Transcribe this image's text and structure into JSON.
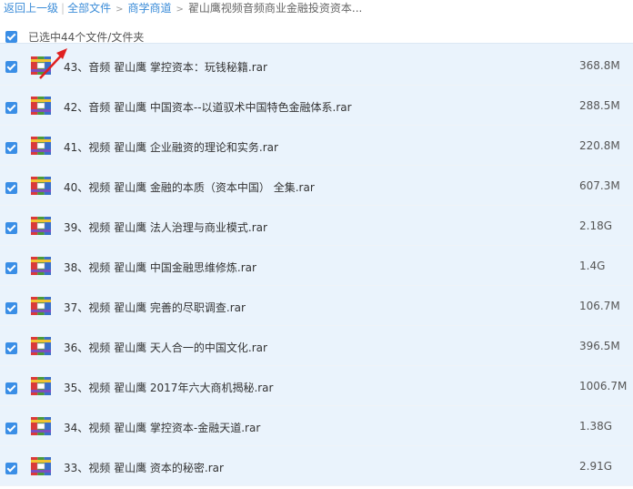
{
  "breadcrumb": {
    "back": "返回上一级",
    "sep": "|",
    "items": [
      "全部文件",
      "商学商道"
    ],
    "arrow": ">",
    "current": "翟山鹰视频音频商业金融投资资本..."
  },
  "selection": {
    "text": "已选中44个文件/文件夹"
  },
  "files": [
    {
      "name": "43、音频 翟山鹰 掌控资本：玩钱秘籍.rar",
      "size": "368.8M"
    },
    {
      "name": "42、音频 翟山鹰 中国资本--以道驭术中国特色金融体系.rar",
      "size": "288.5M"
    },
    {
      "name": "41、视频 翟山鹰 企业融资的理论和实务.rar",
      "size": "220.8M"
    },
    {
      "name": "40、视频 翟山鹰 金融的本质（资本中国） 全集.rar",
      "size": "607.3M"
    },
    {
      "name": "39、视频 翟山鹰 法人治理与商业模式.rar",
      "size": "2.18G"
    },
    {
      "name": "38、视频 翟山鹰 中国金融思维修炼.rar",
      "size": "1.4G"
    },
    {
      "name": "37、视频 翟山鹰 完善的尽职调查.rar",
      "size": "106.7M"
    },
    {
      "name": "36、视频 翟山鹰 天人合一的中国文化.rar",
      "size": "396.5M"
    },
    {
      "name": "35、视频 翟山鹰 2017年六大商机揭秘.rar",
      "size": "1006.7M"
    },
    {
      "name": "34、视频 翟山鹰 掌控资本-金融天道.rar",
      "size": "1.38G"
    },
    {
      "name": "33、视频 翟山鹰 资本的秘密.rar",
      "size": "2.91G"
    }
  ],
  "icons": {
    "checkbox": "checkbox-checked-icon",
    "file": "rar-archive-icon",
    "annotation": "red-arrow-icon"
  },
  "colors": {
    "link": "#3b8cd8",
    "checkbox": "#3a8ee6",
    "row_selected": "#eaf3fc",
    "annotation": "#e02020"
  }
}
